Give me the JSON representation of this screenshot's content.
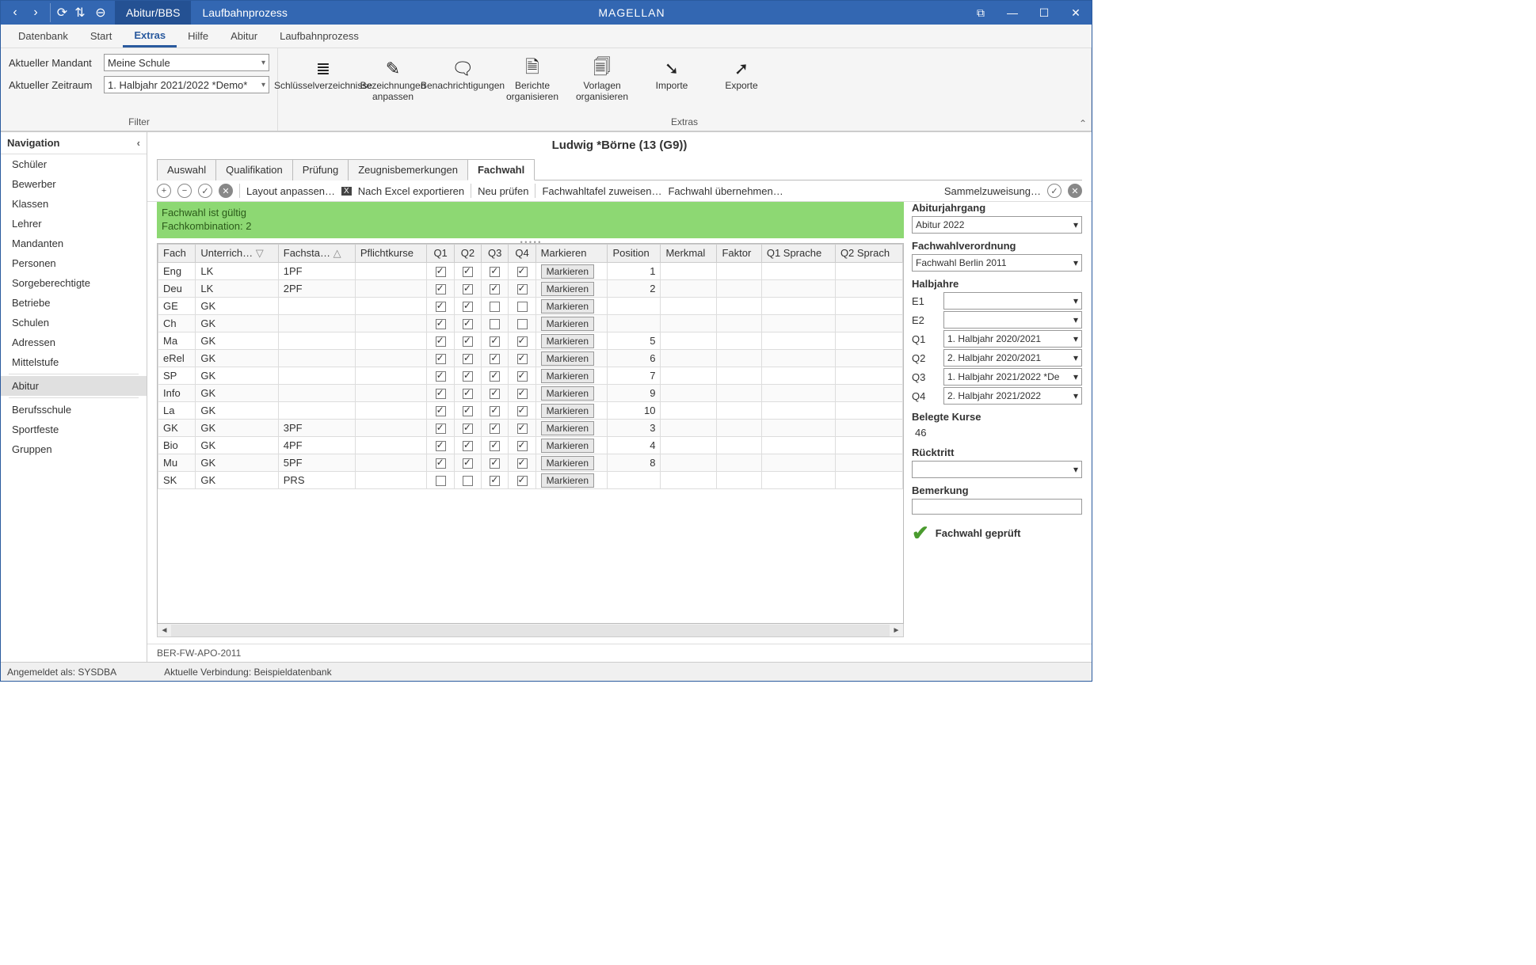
{
  "window": {
    "title": "MAGELLAN"
  },
  "titlebar_tabs": [
    {
      "label": "Abitur/BBS",
      "active": true
    },
    {
      "label": "Laufbahnprozess",
      "active": false
    }
  ],
  "menubar": [
    "Datenbank",
    "Start",
    "Extras",
    "Hilfe",
    "Abitur",
    "Laufbahnprozess"
  ],
  "menubar_active": "Extras",
  "filter": {
    "mandant_label": "Aktueller Mandant",
    "mandant_value": "Meine Schule",
    "zeitraum_label": "Aktueller Zeitraum",
    "zeitraum_value": "1. Halbjahr 2021/2022 *Demo*",
    "group_label": "Filter"
  },
  "ribbon_buttons": [
    {
      "icon": "≣",
      "label": "Schlüsselverzeichnisse"
    },
    {
      "icon": "✎",
      "label": "Bezeichnungen anpassen"
    },
    {
      "icon": "🗨",
      "label": "Benachrichtigungen"
    },
    {
      "icon": "🗎",
      "label": "Berichte organisieren"
    },
    {
      "icon": "🗐",
      "label": "Vorlagen organisieren"
    },
    {
      "icon": "➘",
      "label": "Importe"
    },
    {
      "icon": "➚",
      "label": "Exporte"
    }
  ],
  "ribbon_group_extras": "Extras",
  "navigation": {
    "title": "Navigation",
    "active": "Abitur",
    "items": [
      "Schüler",
      "Bewerber",
      "Klassen",
      "Lehrer",
      "Mandanten",
      "Personen",
      "Sorgeberechtigte",
      "Betriebe",
      "Schulen",
      "Adressen",
      "Mittelstufe",
      "Abitur",
      "Berufsschule",
      "Sportfeste",
      "Gruppen"
    ]
  },
  "page_title": "Ludwig *Börne (13 (G9))",
  "tabs": [
    "Auswahl",
    "Qualifikation",
    "Prüfung",
    "Zeugnisbemerkungen",
    "Fachwahl"
  ],
  "tabs_active": "Fachwahl",
  "toolbar": {
    "layout": "Layout anpassen…",
    "excel": "Nach Excel exportieren",
    "neu": "Neu prüfen",
    "tafel": "Fachwahltafel zuweisen…",
    "uebern": "Fachwahl übernehmen…",
    "sammel": "Sammelzuweisung…"
  },
  "greenbox": {
    "l1": "Fachwahl ist gültig",
    "l2": "Fachkombination: 2"
  },
  "columns": [
    "Fach",
    "Unterrich…",
    "Fachsta…",
    "Pflichtkurse",
    "Q1",
    "Q2",
    "Q3",
    "Q4",
    "Markieren",
    "Position",
    "Merkmal",
    "Faktor",
    "Q1 Sprache",
    "Q2 Sprach"
  ],
  "mark_label": "Markieren",
  "rows": [
    {
      "fach": "Eng",
      "ua": "LK",
      "fs": "1PF",
      "q": [
        1,
        1,
        1,
        1
      ],
      "pos": "1"
    },
    {
      "fach": "Deu",
      "ua": "LK",
      "fs": "2PF",
      "q": [
        1,
        1,
        1,
        1
      ],
      "pos": "2"
    },
    {
      "fach": "GE",
      "ua": "GK",
      "fs": "",
      "q": [
        1,
        1,
        0,
        0
      ],
      "pos": ""
    },
    {
      "fach": "Ch",
      "ua": "GK",
      "fs": "",
      "q": [
        1,
        1,
        0,
        0
      ],
      "pos": ""
    },
    {
      "fach": "Ma",
      "ua": "GK",
      "fs": "",
      "q": [
        1,
        1,
        1,
        1
      ],
      "pos": "5"
    },
    {
      "fach": "eRel",
      "ua": "GK",
      "fs": "",
      "q": [
        1,
        1,
        1,
        1
      ],
      "pos": "6"
    },
    {
      "fach": "SP",
      "ua": "GK",
      "fs": "",
      "q": [
        1,
        1,
        1,
        1
      ],
      "pos": "7"
    },
    {
      "fach": "Info",
      "ua": "GK",
      "fs": "",
      "q": [
        1,
        1,
        1,
        1
      ],
      "pos": "9"
    },
    {
      "fach": "La",
      "ua": "GK",
      "fs": "",
      "q": [
        1,
        1,
        1,
        1
      ],
      "pos": "10"
    },
    {
      "fach": "GK",
      "ua": "GK",
      "fs": "3PF",
      "q": [
        1,
        1,
        1,
        1
      ],
      "pos": "3"
    },
    {
      "fach": "Bio",
      "ua": "GK",
      "fs": "4PF",
      "q": [
        1,
        1,
        1,
        1
      ],
      "pos": "4"
    },
    {
      "fach": "Mu",
      "ua": "GK",
      "fs": "5PF",
      "q": [
        1,
        1,
        1,
        1
      ],
      "pos": "8"
    },
    {
      "fach": "SK",
      "ua": "GK",
      "fs": "PRS",
      "q": [
        0,
        0,
        1,
        1
      ],
      "pos": ""
    }
  ],
  "right": {
    "jahrgang_lbl": "Abiturjahrgang",
    "jahrgang_val": "Abitur 2022",
    "verord_lbl": "Fachwahlverordnung",
    "verord_val": "Fachwahl Berlin 2011",
    "halb_lbl": "Halbjahre",
    "halb": [
      {
        "k": "E1",
        "v": ""
      },
      {
        "k": "E2",
        "v": ""
      },
      {
        "k": "Q1",
        "v": "1. Halbjahr 2020/2021"
      },
      {
        "k": "Q2",
        "v": "2. Halbjahr 2020/2021"
      },
      {
        "k": "Q3",
        "v": "1. Halbjahr 2021/2022 *De"
      },
      {
        "k": "Q4",
        "v": "2. Halbjahr 2021/2022"
      }
    ],
    "belegte_lbl": "Belegte Kurse",
    "belegte_val": "46",
    "rueck_lbl": "Rücktritt",
    "bem_lbl": "Bemerkung",
    "geprueft": "Fachwahl geprüft"
  },
  "footer_code": "BER-FW-APO-2011",
  "status": {
    "login": "Angemeldet als: SYSDBA",
    "conn": "Aktuelle Verbindung: Beispieldatenbank"
  }
}
